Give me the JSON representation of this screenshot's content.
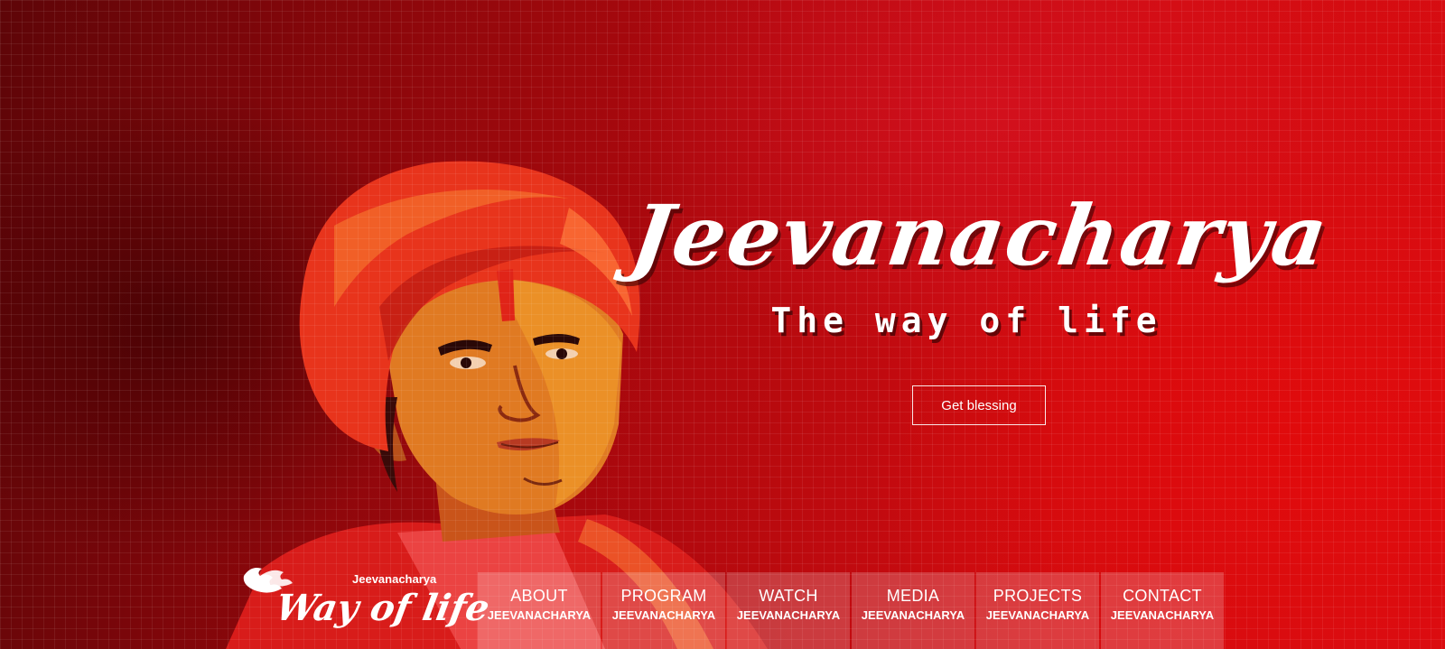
{
  "hero": {
    "title": "Jeevanacharya",
    "tagline": "The way of life",
    "cta_label": "Get blessing"
  },
  "logo": {
    "small_text": "Jeevanacharya",
    "big_text": "Way of life",
    "icon": "wings-icon"
  },
  "nav": {
    "items": [
      {
        "label": "ABOUT",
        "sub": "JEEVANACHARYA"
      },
      {
        "label": "PROGRAM",
        "sub": "JEEVANACHARYA"
      },
      {
        "label": "WATCH",
        "sub": "JEEVANACHARYA"
      },
      {
        "label": "MEDIA",
        "sub": "JEEVANACHARYA"
      },
      {
        "label": "PROJECTS",
        "sub": "JEEVANACHARYA"
      },
      {
        "label": "CONTACT",
        "sub": "JEEVANACHARYA"
      }
    ]
  },
  "colors": {
    "background_dark": "#5e0508",
    "background_bright": "#d80d12",
    "turban": "#e8341c",
    "skin": "#e0701e",
    "text": "#ffffff"
  }
}
